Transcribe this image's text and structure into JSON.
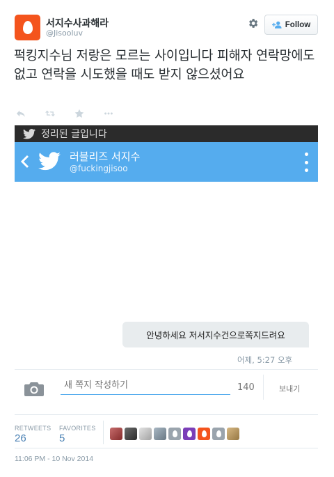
{
  "tweet": {
    "display_name": "서지수사과해라",
    "handle": "@Jisooluv",
    "follow_label": "Follow",
    "text": "퍽킹지수님 저랑은 모르는 사이입니다 피해자 연락망에도 없고 연락을 시도했을 때도 받지 않으셨어요",
    "avatar_color": "#f4541d"
  },
  "embedded": {
    "banner_text": "정리된 글입니다",
    "profile_name": "러블리즈 서지수",
    "profile_handle": "@fuckingjisoo",
    "bar_color": "#55acee",
    "message_text": "안녕하세요 저서지수건으로쪽지드려요",
    "message_time": "어제, 5:27 오후",
    "compose_placeholder": "새 쪽지 작성하기",
    "char_count": "140",
    "send_label": "보내기"
  },
  "stats": {
    "retweets_label": "RETWEETS",
    "retweets_value": "26",
    "favorites_label": "FAVORITES",
    "favorites_value": "5",
    "favoriters": [
      {
        "type": "photo",
        "color": "#b23a3a"
      },
      {
        "type": "photo",
        "color": "#3a3a3a"
      },
      {
        "type": "photo",
        "color": "#d9d9d9"
      },
      {
        "type": "photo",
        "color": "#8ca0b0"
      },
      {
        "type": "egg",
        "color": "#9aa4ad"
      },
      {
        "type": "egg",
        "color": "#7b3fb8"
      },
      {
        "type": "egg",
        "color": "#f4541d"
      },
      {
        "type": "egg",
        "color": "#9aa4ad"
      },
      {
        "type": "photo",
        "color": "#c9a05a"
      }
    ]
  },
  "timestamp": "11:06 PM - 10 Nov 2014"
}
